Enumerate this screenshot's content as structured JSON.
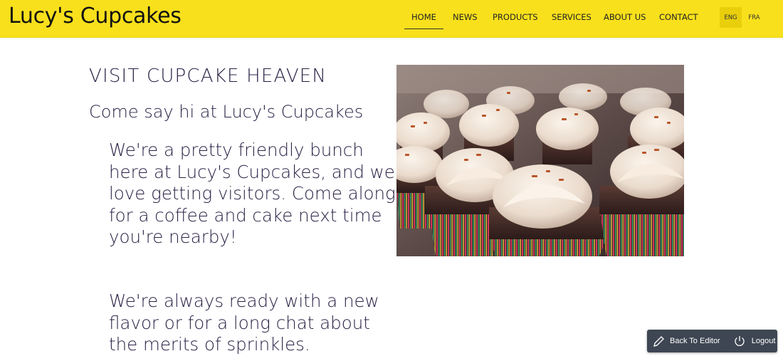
{
  "header": {
    "logo": "Lucy's Cupcakes",
    "nav": [
      {
        "label": "HOME",
        "active": true
      },
      {
        "label": "NEWS",
        "active": false
      },
      {
        "label": "PRODUCTS",
        "active": false
      },
      {
        "label": "SERVICES",
        "active": false
      },
      {
        "label": "ABOUT US",
        "active": false
      },
      {
        "label": "CONTACT",
        "active": false
      }
    ],
    "languages": [
      {
        "label": "ENG",
        "active": true
      },
      {
        "label": "FRA",
        "active": false
      }
    ]
  },
  "main": {
    "heading": "VISIT CUPCAKE HEAVEN",
    "subheading": "Come say hi at Lucy's Cupcakes",
    "paragraph_1": "We're a pretty friendly bunch here at Lucy's Cupcakes, and we love getting visitors. Come along for a coffee and cake next time you're nearby!",
    "paragraph_2": "We're always ready with a new flavor or for a long chat about the merits of sprinkles."
  },
  "editor_bar": {
    "back_label": "Back To Editor",
    "logout_label": "Logout",
    "back_icon": "pencil-icon",
    "logout_icon": "power-icon"
  },
  "colors": {
    "header_bg": "#f9e01c",
    "text": "#2b2145",
    "editor_bar_bg": "#3e4653"
  }
}
